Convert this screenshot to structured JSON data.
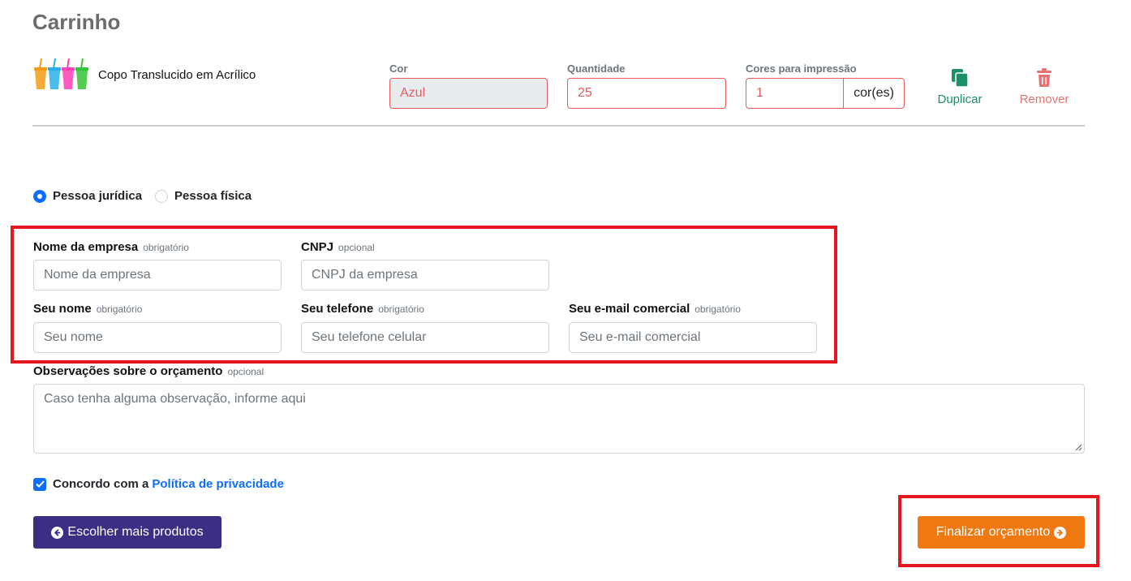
{
  "header": {
    "title": "Carrinho"
  },
  "cart_item": {
    "product_name": "Copo Translucido em Acrílico",
    "color": {
      "label": "Cor",
      "value": "Azul"
    },
    "quantity": {
      "label": "Quantidade",
      "value": "25"
    },
    "print_colors": {
      "label": "Cores para impressão",
      "value": "1",
      "addon": "cor(es)"
    },
    "actions": {
      "duplicate": "Duplicar",
      "remove": "Remover"
    },
    "cup_colors": [
      "#f39c12",
      "#2ab0e8",
      "#ff3fb4",
      "#36c236"
    ]
  },
  "person_type": {
    "options": [
      {
        "label": "Pessoa jurídica",
        "selected": true
      },
      {
        "label": "Pessoa física",
        "selected": false
      }
    ]
  },
  "form": {
    "company_name": {
      "label": "Nome da empresa",
      "hint": "obrigatório",
      "placeholder": "Nome da empresa"
    },
    "cnpj": {
      "label": "CNPJ",
      "hint": "opcional",
      "placeholder": "CNPJ da empresa"
    },
    "your_name": {
      "label": "Seu nome",
      "hint": "obrigatório",
      "placeholder": "Seu nome"
    },
    "phone": {
      "label": "Seu telefone",
      "hint": "obrigatório",
      "placeholder": "Seu telefone celular"
    },
    "email": {
      "label": "Seu e-mail comercial",
      "hint": "obrigatório",
      "placeholder": "Seu e-mail comercial"
    },
    "notes": {
      "label": "Observações sobre o orçamento",
      "hint": "opcional",
      "placeholder": "Caso tenha alguma observação, informe aqui"
    }
  },
  "consent": {
    "text": "Concordo com a",
    "link": "Política de privacidade",
    "checked": true
  },
  "buttons": {
    "back": "Escolher mais produtos",
    "finish": "Finalizar orçamento"
  },
  "colors": {
    "accent_blue": "#0d6efd",
    "back_button": "#3a2f85",
    "finish_button": "#f07810",
    "error_red": "#e35d5d",
    "highlight_red": "#e3161f",
    "duplicate_green": "#1a8f6a"
  }
}
